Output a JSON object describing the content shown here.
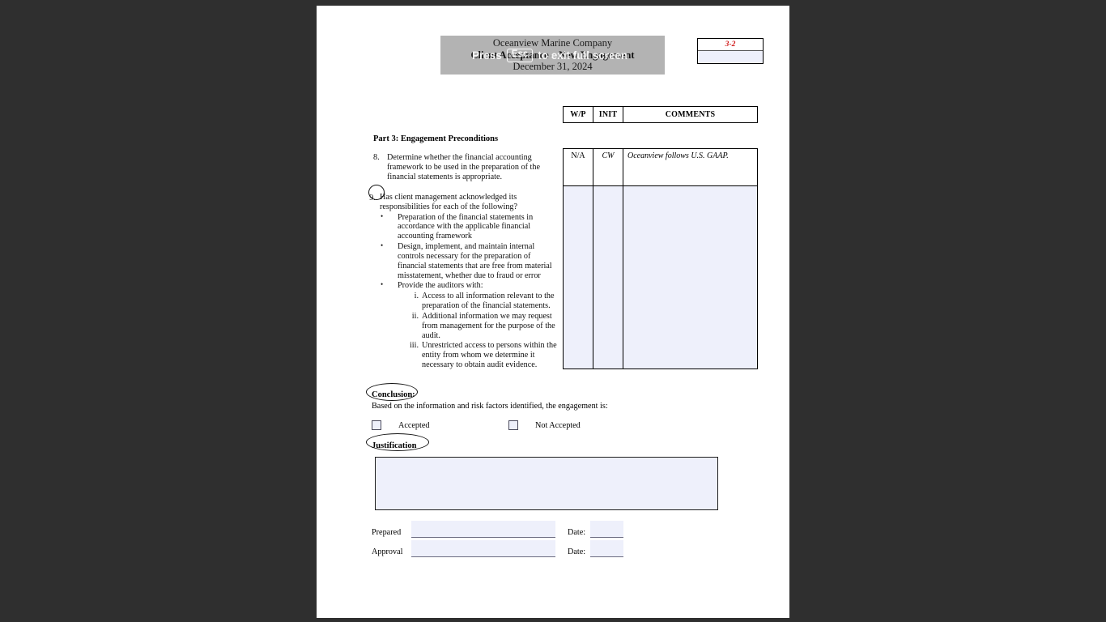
{
  "overlay": {
    "prefix": "Press",
    "key": "Esc",
    "suffix": "to exit full screen"
  },
  "header": {
    "company": "Oceanview Marine Company",
    "form_title": "Client Acceptance – New Engagement",
    "period_date": "December 31, 2024"
  },
  "page_ref": {
    "value": "3-2",
    "input_value": ""
  },
  "table": {
    "columns": [
      "W/P",
      "INIT",
      "COMMENTS"
    ],
    "rows": [
      {
        "wp": "N/A",
        "init": "CW",
        "comments": "Oceanview follows U.S. GAAP."
      },
      {
        "wp": "",
        "init": "",
        "comments": ""
      }
    ]
  },
  "part": {
    "title": "Part 3:  Engagement Preconditions"
  },
  "questions": [
    {
      "number": "8.",
      "text": "Determine whether the financial accounting framework to be used in the preparation of the financial statements is appropriate."
    },
    {
      "number": "9.",
      "text": "Has client management acknowledged its responsibilities for each of the following?",
      "bullets": [
        {
          "text": "Preparation of the financial statements in accordance with the applicable financial accounting framework"
        },
        {
          "text": "Design, implement, and maintain internal controls necessary for the preparation of financial statements that are free from material misstatement, whether due to fraud or error"
        },
        {
          "text": "Provide the auditors with:",
          "subitems": [
            {
              "marker": "i.",
              "text": "Access to all information relevant to the preparation of the financial statements."
            },
            {
              "marker": "ii.",
              "text": "Additional information we may request from management for the purpose of the audit."
            },
            {
              "marker": "iii.",
              "text": "Unrestricted access to persons within the entity from whom we determine it necessary to obtain audit evidence."
            }
          ]
        }
      ]
    }
  ],
  "conclusion": {
    "label": "Conclusion:",
    "statement": "Based on the information and risk factors identified, the engagement is:",
    "options": [
      {
        "label": "Accepted",
        "checked": false
      },
      {
        "label": "Not Accepted",
        "checked": false
      }
    ]
  },
  "justification": {
    "label": "Justification",
    "value": ""
  },
  "signature": {
    "prepared_label": "Prepared",
    "prepared_value": "",
    "prepared_date_label": "Date:",
    "prepared_date_value": "",
    "approval_label": "Approval",
    "approval_value": "",
    "approval_date_label": "Date:",
    "approval_date_value": ""
  },
  "colors": {
    "app_background": "#2f2f2f",
    "page_background": "#ffffff",
    "banner_gray": "#b3b3b3",
    "field_blue": "#eef0fb",
    "page_ref_red": "#d01818"
  }
}
